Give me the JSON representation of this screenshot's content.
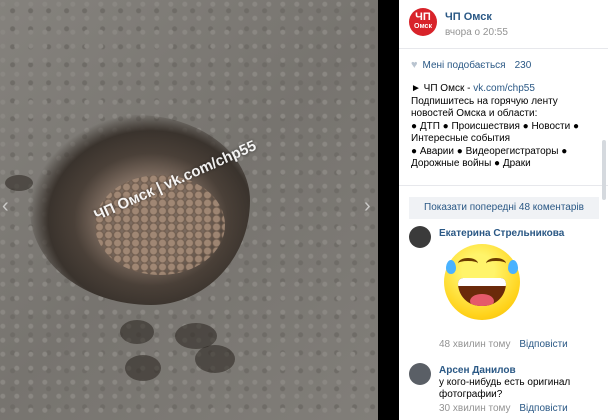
{
  "photo": {
    "watermark": "ЧП Омск | vk.com/chp55",
    "prev_arrow": "‹",
    "next_arrow": "›"
  },
  "post": {
    "logo_text_top": "ЧП",
    "logo_text_bottom": "Омск",
    "group_name": "ЧП Омск",
    "time": "вчора о 20:55",
    "likes_label": "Мені подобається",
    "likes_count": "230",
    "text_lines": [
      "► ЧП Омск - ",
      "Подпишитесь на горячую ленту новостей Омска и области:",
      "● ДТП ● Происшествия ● Новости ● Интересные события",
      "● Аварии ● Видеорегистраторы ● Дорожные войны ● Драки"
    ],
    "link": "vk.com/chp55"
  },
  "comments": {
    "show_previous": "Показати попередні 48 коментарів",
    "items": [
      {
        "author": "Екатерина Стрельникова",
        "text": "",
        "time": "48 хвилин тому",
        "reply": "Відповісти"
      },
      {
        "author": "Арсен Данилов",
        "text": "у кого-нибудь есть оригинал фотографии?",
        "time": "30 хвилин тому",
        "reply": "Відповісти"
      }
    ]
  },
  "colors": {
    "accent": "#2a5885",
    "logo": "#d8232a",
    "emoji": "#ffd21a"
  },
  "icons": [
    "heart-icon",
    "chevron-left-icon",
    "chevron-right-icon",
    "laughing-emoji-icon"
  ]
}
